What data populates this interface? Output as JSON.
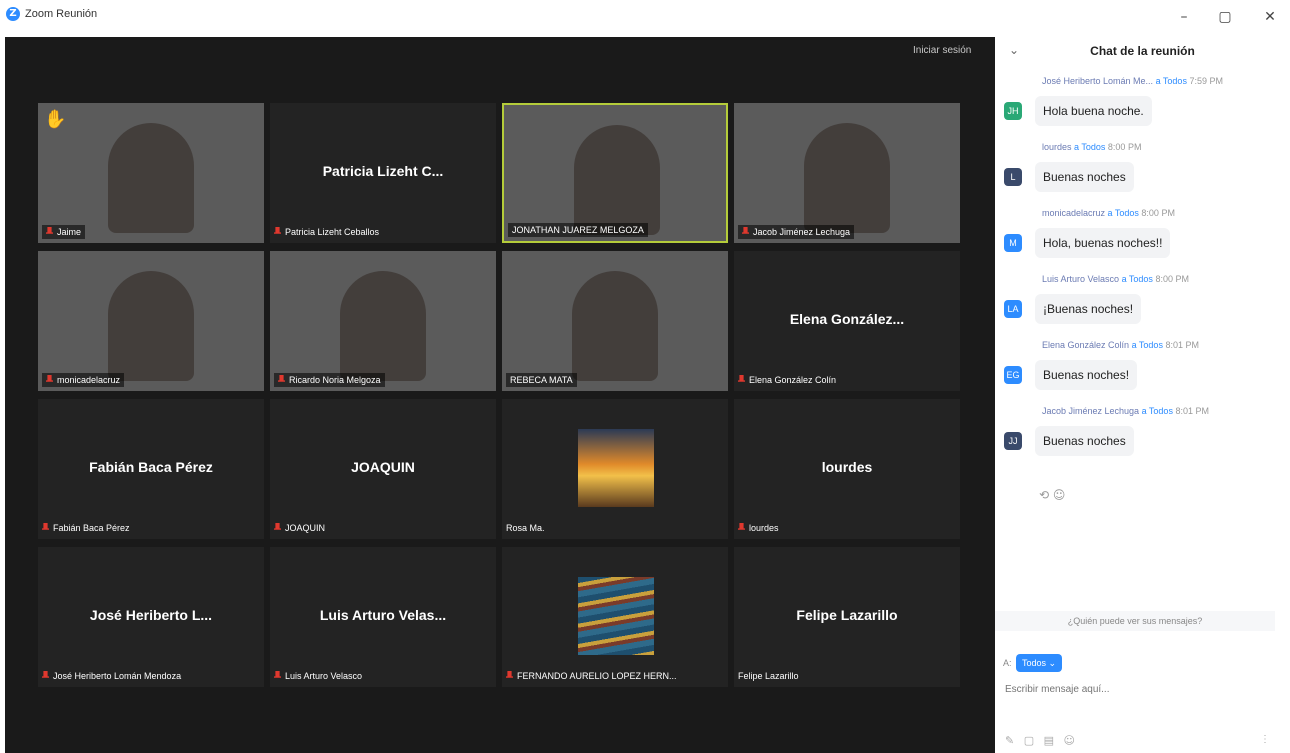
{
  "window": {
    "title": "Zoom Reunión",
    "minimize": "–",
    "restore": "▢",
    "close": "✕"
  },
  "meeting": {
    "signin_label": "Iniciar sesión",
    "tiles": [
      {
        "name": "Jaime",
        "big": "",
        "muted": true,
        "video": true,
        "hand": true
      },
      {
        "name": "Patricia Lizeht Ceballos",
        "big": "Patricia Lizeht C...",
        "muted": true,
        "video": false
      },
      {
        "name": "JONATHAN JUAREZ MELGOZA",
        "big": "",
        "muted": false,
        "video": true,
        "active": true
      },
      {
        "name": "Jacob Jiménez Lechuga",
        "big": "",
        "muted": true,
        "video": true
      },
      {
        "name": "monicadelacruz",
        "big": "",
        "muted": true,
        "video": true
      },
      {
        "name": "Ricardo Noria Melgoza",
        "big": "",
        "muted": true,
        "video": true
      },
      {
        "name": "REBECA MATA",
        "big": "",
        "muted": false,
        "video": true
      },
      {
        "name": "Elena González Colín",
        "big": "Elena González...",
        "muted": true,
        "video": false
      },
      {
        "name": "Fabián Baca Pérez",
        "big": "Fabián Baca Pérez",
        "muted": true,
        "video": false
      },
      {
        "name": "JOAQUIN",
        "big": "JOAQUIN",
        "muted": true,
        "video": false
      },
      {
        "name": "Rosa Ma.",
        "big": "",
        "muted": false,
        "video": false,
        "image": "sunset"
      },
      {
        "name": "lourdes",
        "big": "lourdes",
        "muted": true,
        "video": false
      },
      {
        "name": "José Heriberto Lomán Mendoza",
        "big": "José Heriberto L...",
        "muted": true,
        "video": false
      },
      {
        "name": "Luis Arturo Velasco",
        "big": "Luis Arturo Velas...",
        "muted": true,
        "video": false
      },
      {
        "name": "FERNANDO AURELIO LOPEZ HERN...",
        "big": "",
        "muted": true,
        "video": false,
        "image": "abstract"
      },
      {
        "name": "Felipe Lazarillo",
        "big": "Felipe Lazarillo",
        "muted": false,
        "video": false
      }
    ]
  },
  "chat": {
    "title": "Chat de la reunión",
    "chevron": "⌄",
    "messages": [
      {
        "sender": "José Heriberto Lomán Me...",
        "to": "a Todos",
        "time": "7:59 PM",
        "initials": "JH",
        "color": "#2aa876",
        "text": "Hola  buena noche."
      },
      {
        "sender": "lourdes",
        "to": "a Todos",
        "time": "8:00 PM",
        "initials": "L",
        "color": "#3a4a6b",
        "text": "Buenas noches"
      },
      {
        "sender": "monicadelacruz",
        "to": "a Todos",
        "time": "8:00 PM",
        "initials": "M",
        "color": "#2d8cff",
        "text": "Hola, buenas noches!!"
      },
      {
        "sender": "Luis Arturo Velasco",
        "to": "a Todos",
        "time": "8:00 PM",
        "initials": "LA",
        "color": "#2d8cff",
        "text": "¡Buenas noches!"
      },
      {
        "sender": "Elena González  Colín",
        "to": "a Todos",
        "time": "8:01 PM",
        "initials": "EG",
        "color": "#2d8cff",
        "text": "Buenas noches!"
      },
      {
        "sender": "Jacob Jiménez Lechuga",
        "to": "a Todos",
        "time": "8:01 PM",
        "initials": "JJ",
        "color": "#3a4a6b",
        "text": "Buenas noches"
      }
    ],
    "reactions": "⟲ ☺",
    "who_can_see": "¿Quién puede ver sus mensajes?",
    "to_label": "A:",
    "to_value": "Todos ⌄",
    "input_placeholder": "Escribir mensaje aquí...",
    "tools": [
      "✎",
      "▢",
      "▤",
      "☺"
    ],
    "more": "⋮"
  }
}
